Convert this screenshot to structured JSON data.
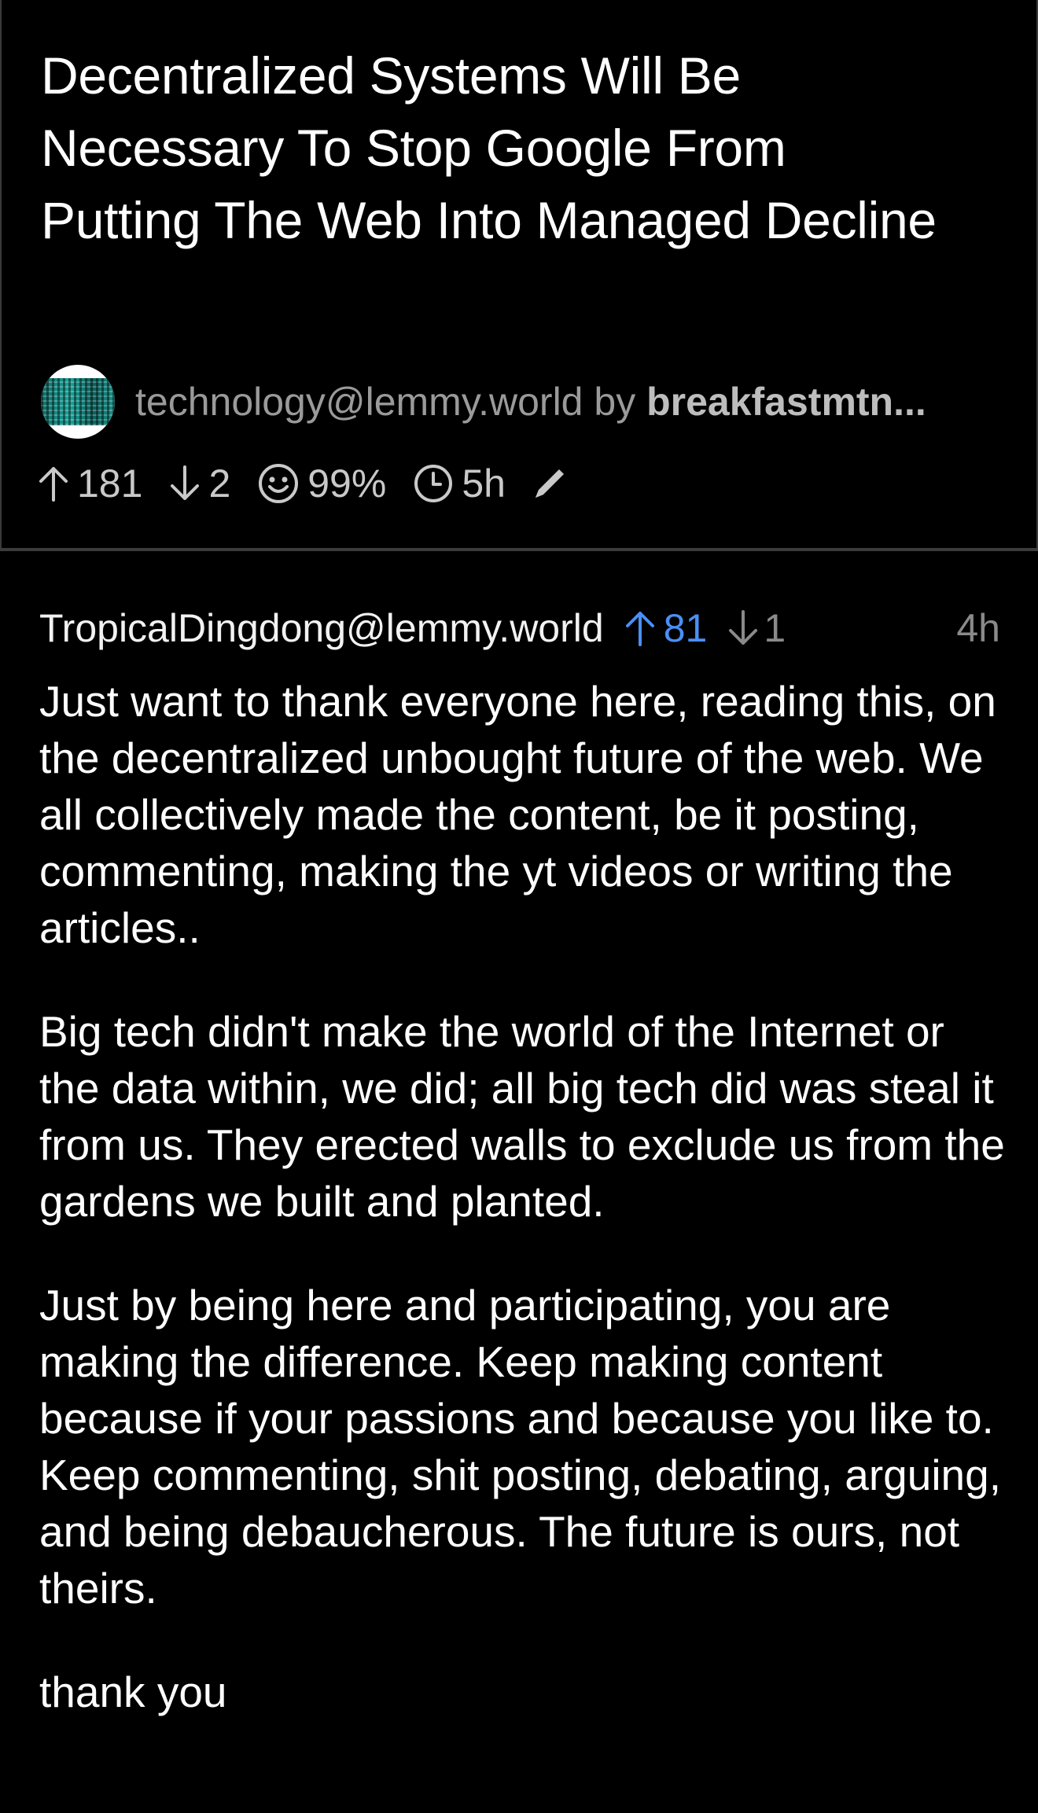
{
  "post": {
    "title": "Decentralized Systems Will Be Necessary To Stop Google From Putting The Web Into Managed Decline",
    "community": "technology@lemmy.world",
    "by": "by",
    "author": "breakfastmtn...",
    "upvotes": "181",
    "downvotes": "2",
    "score_percent": "99%",
    "age": "5h",
    "icons": [
      "avatar-image",
      "arrow-up-icon",
      "arrow-down-icon",
      "smiley-icon",
      "clock-icon",
      "pencil-icon"
    ]
  },
  "comment": {
    "author": "TropicalDingdong@lemmy.world",
    "upvotes": "81",
    "downvotes": "1",
    "age": "4h",
    "paragraphs": [
      "Just want to thank everyone here, reading this, on the decentralized unbought future of the web. We all collectively made the content, be it posting, commenting, making the yt videos or writing the articles..",
      "Big tech didn't make the world of the Internet or the data within, we did; all big tech did was steal it from us. They erected walls to exclude us from the gardens we built and planted.",
      "Just by being here and participating, you are making the difference. Keep making content because if your passions and because you like to. Keep commenting, shit posting, debating, arguing, and being debaucherous. The future is ours, not theirs.",
      "thank you"
    ]
  },
  "colors": {
    "background": "#000000",
    "upvote_active": "#4a8ff5",
    "muted_text": "#9a9a9a",
    "divider": "#3c3c3c"
  }
}
